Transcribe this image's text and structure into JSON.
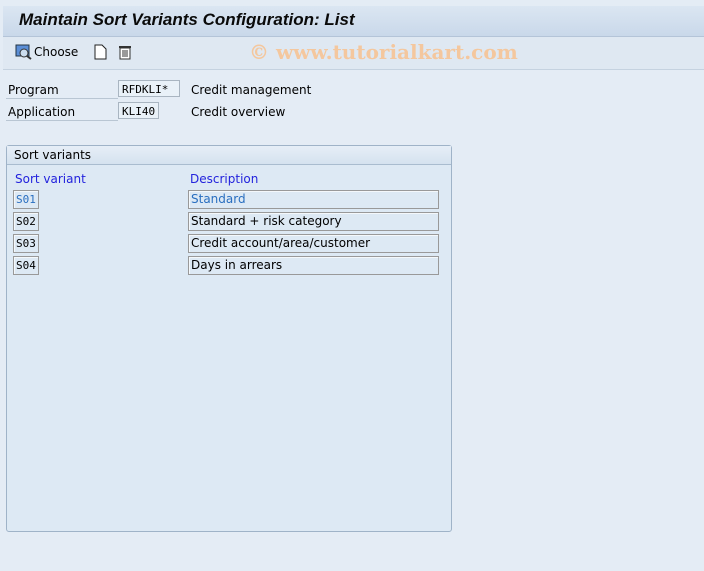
{
  "title": "Maintain Sort Variants Configuration: List",
  "toolbar": {
    "choose_label": "Choose",
    "watermark": "© www.tutorialkart.com"
  },
  "fields": {
    "program": {
      "label": "Program",
      "value": "RFDKLI*",
      "text": "Credit management"
    },
    "application": {
      "label": "Application",
      "value": "KLI40",
      "text": "Credit overview"
    }
  },
  "group": {
    "title": "Sort variants",
    "col_variant": "Sort variant",
    "col_description": "Description",
    "rows": [
      {
        "code": "S01",
        "description": "Standard"
      },
      {
        "code": "S02",
        "description": "Standard + risk category"
      },
      {
        "code": "S03",
        "description": "Credit account/area/customer"
      },
      {
        "code": "S04",
        "description": "Days in arrears"
      }
    ]
  },
  "colors": {
    "header_text": "#2323dd",
    "selected_text": "#2a6fc0"
  }
}
